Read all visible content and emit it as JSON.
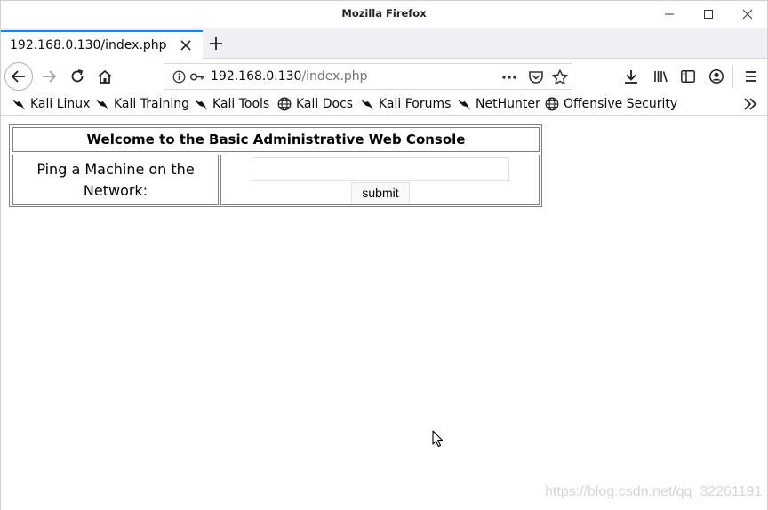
{
  "window": {
    "title": "Mozilla Firefox"
  },
  "tabs": [
    {
      "title": "192.168.0.130/index.php",
      "active": true
    }
  ],
  "urlbar": {
    "host": "192.168.0.130",
    "path": "/index.php"
  },
  "bookmarks": [
    {
      "label": "Kali Linux",
      "icon": "kali-dragon-icon"
    },
    {
      "label": "Kali Training",
      "icon": "kali-dragon-icon"
    },
    {
      "label": "Kali Tools",
      "icon": "kali-dragon-icon"
    },
    {
      "label": "Kali Docs",
      "icon": "globe-icon"
    },
    {
      "label": "Kali Forums",
      "icon": "kali-dragon-icon"
    },
    {
      "label": "NetHunter",
      "icon": "kali-dragon-icon"
    },
    {
      "label": "Offensive Security",
      "icon": "globe-icon"
    }
  ],
  "page": {
    "heading": "Welcome to the Basic Administrative Web Console",
    "ping_label": "Ping a Machine on the Network:",
    "ping_input_value": "",
    "submit_label": "submit"
  },
  "watermark": "https://blog.csdn.net/qq_32261191",
  "colors": {
    "tab_accent": "#0a84ff",
    "chrome_bg": "#f0f0f4",
    "border": "#d7d7db"
  }
}
